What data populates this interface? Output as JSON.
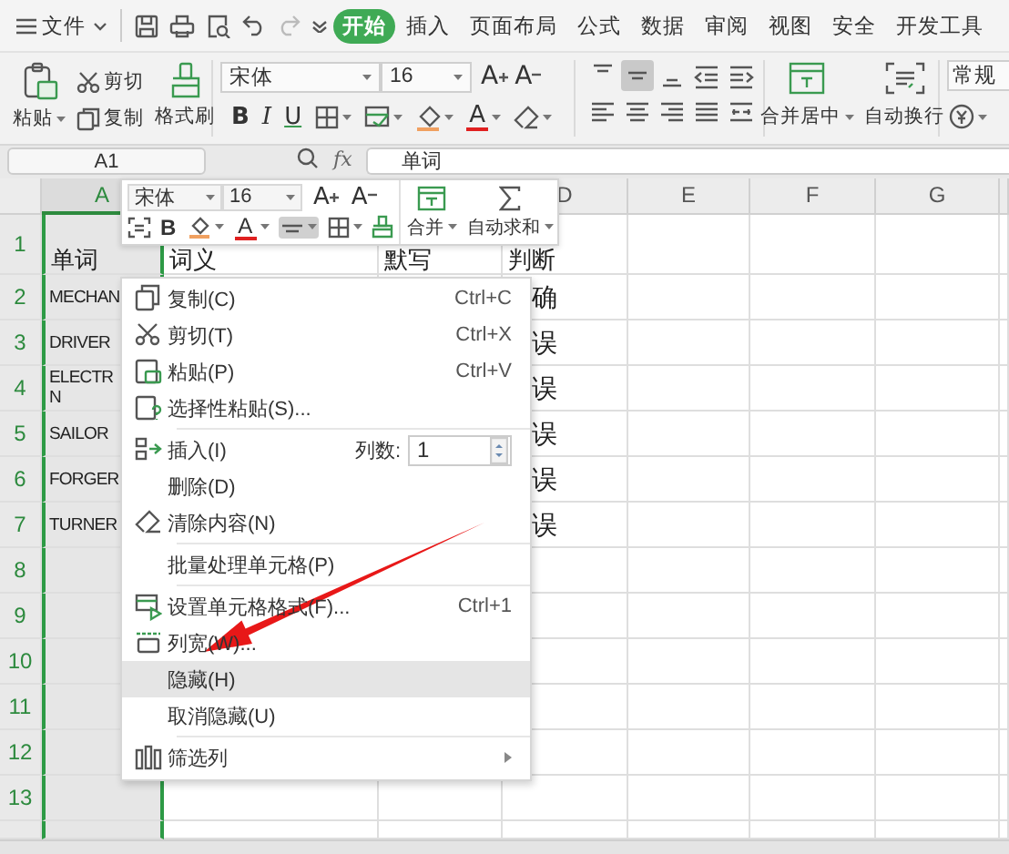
{
  "menubar": {
    "file_menu": "文件",
    "tabs": [
      {
        "label": "开始",
        "selected": true
      },
      {
        "label": "插入",
        "selected": false
      },
      {
        "label": "页面布局",
        "selected": false
      },
      {
        "label": "公式",
        "selected": false
      },
      {
        "label": "数据",
        "selected": false
      },
      {
        "label": "审阅",
        "selected": false
      },
      {
        "label": "视图",
        "selected": false
      },
      {
        "label": "安全",
        "selected": false
      },
      {
        "label": "开发工具",
        "selected": false
      }
    ]
  },
  "ribbon": {
    "paste": "粘贴",
    "cut": "剪切",
    "copy": "复制",
    "format_painter": "格式刷",
    "font_name": "宋体",
    "font_size": "16",
    "grow_font": "A",
    "shrink_font": "A",
    "bold": "B",
    "italic": "I",
    "underline": "U",
    "font_color": "A",
    "align_buttons": [
      {
        "selected": false
      },
      {
        "selected": true
      },
      {
        "selected": false
      },
      {
        "selected": false
      },
      {
        "selected": false
      },
      {
        "selected": false
      },
      {
        "selected": false
      },
      {
        "selected": false
      },
      {
        "selected": false
      },
      {
        "selected": false
      }
    ],
    "merge": "合并居中",
    "wrap": "自动换行",
    "number_format": "常规"
  },
  "formula_bar": {
    "name_box": "A1",
    "fx": "fx",
    "value": "单词"
  },
  "mini_toolbar": {
    "font_name": "宋体",
    "font_size": "16",
    "grow_font": "A",
    "shrink_font": "A",
    "bold": "B",
    "font_color": "A",
    "align_selected": true,
    "merge": "合并",
    "autosum": "自动求和"
  },
  "sheet": {
    "columns": [
      {
        "label": "A",
        "selected": true
      },
      null,
      null,
      {
        "label": "D",
        "selected": false
      },
      {
        "label": "E",
        "selected": false
      },
      {
        "label": "F",
        "selected": false
      },
      {
        "label": "G",
        "selected": false
      }
    ],
    "rows": [
      {
        "label": "1",
        "cells": [
          "单词",
          "词义",
          "默写",
          "判断",
          null,
          null,
          null
        ]
      },
      {
        "label": "2",
        "cells": [
          "MECHAN",
          null,
          null,
          "确",
          null,
          null,
          null
        ]
      },
      {
        "label": "3",
        "cells": [
          "DRIVER",
          null,
          null,
          "误",
          null,
          null,
          null
        ]
      },
      {
        "label": "4",
        "cells": [
          "ELECTR\nN",
          null,
          null,
          "误",
          null,
          null,
          null
        ]
      },
      {
        "label": "5",
        "cells": [
          "SAILOR",
          null,
          null,
          "误",
          null,
          null,
          null
        ]
      },
      {
        "label": "6",
        "cells": [
          "FORGER",
          null,
          null,
          "误",
          null,
          null,
          null
        ]
      },
      {
        "label": "7",
        "cells": [
          "TURNER",
          null,
          null,
          "误",
          null,
          null,
          null
        ]
      },
      {
        "label": "8",
        "cells": [
          null,
          null,
          null,
          null,
          null,
          null,
          null
        ]
      },
      {
        "label": "9",
        "cells": [
          null,
          null,
          null,
          null,
          null,
          null,
          null
        ]
      },
      {
        "label": "10",
        "cells": [
          null,
          null,
          null,
          null,
          null,
          null,
          null
        ]
      },
      {
        "label": "11",
        "cells": [
          null,
          null,
          null,
          null,
          null,
          null,
          null
        ]
      },
      {
        "label": "12",
        "cells": [
          null,
          null,
          null,
          null,
          null,
          null,
          null
        ]
      },
      {
        "label": "13",
        "cells": [
          null,
          null,
          null,
          null,
          null,
          null,
          null
        ]
      }
    ]
  },
  "context_menu": {
    "items": [
      {
        "kind": "item",
        "label": "复制(C)",
        "shortcut": "Ctrl+C",
        "selected": false
      },
      {
        "kind": "item",
        "label": "剪切(T)",
        "shortcut": "Ctrl+X",
        "selected": false
      },
      {
        "kind": "item",
        "label": "粘贴(P)",
        "shortcut": "Ctrl+V",
        "selected": false
      },
      {
        "kind": "item",
        "label": "选择性粘贴(S)...",
        "selected": false
      },
      {
        "kind": "separator"
      },
      {
        "kind": "spin",
        "label": "插入(I)",
        "field_label": "列数:",
        "value": "1",
        "selected": false
      },
      {
        "kind": "item",
        "label": "删除(D)",
        "selected": false
      },
      {
        "kind": "item",
        "label": "清除内容(N)",
        "selected": false
      },
      {
        "kind": "separator"
      },
      {
        "kind": "item",
        "label": "批量处理单元格(P)",
        "selected": false
      },
      {
        "kind": "separator"
      },
      {
        "kind": "item",
        "label": "设置单元格格式(F)...",
        "shortcut": "Ctrl+1",
        "selected": false
      },
      {
        "kind": "item",
        "label": "列宽(W)...",
        "selected": false
      },
      {
        "kind": "item",
        "label": "隐藏(H)",
        "selected": true
      },
      {
        "kind": "item",
        "label": "取消隐藏(U)",
        "selected": false
      },
      {
        "kind": "separator"
      },
      {
        "kind": "submenu",
        "label": "筛选列",
        "selected": false
      }
    ]
  }
}
